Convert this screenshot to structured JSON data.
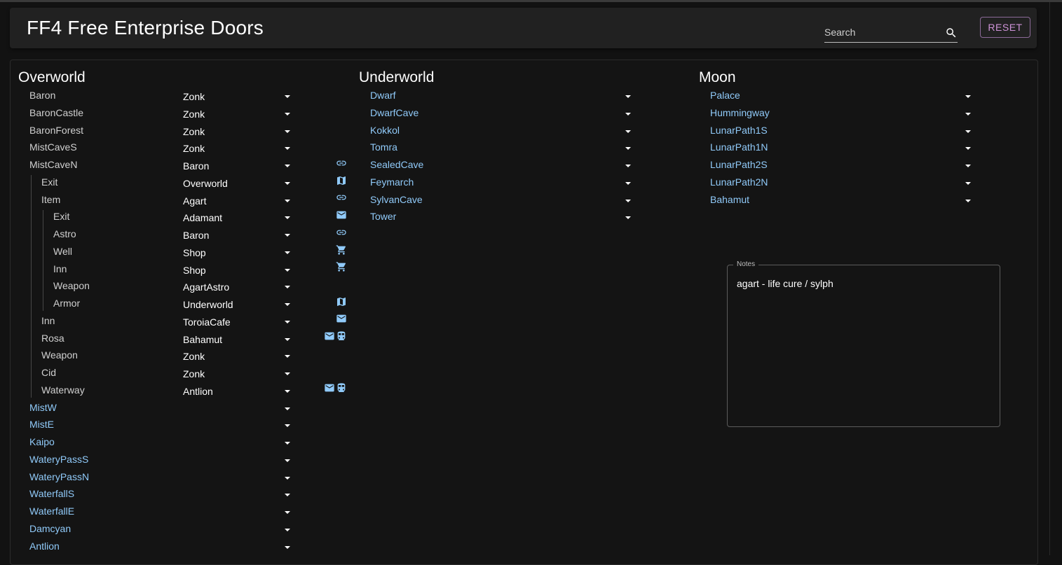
{
  "app": {
    "title": "FF4 Free Enterprise Doors",
    "search_placeholder": "Search",
    "reset_label": "RESET"
  },
  "overworld": {
    "heading": "Overworld",
    "rows": [
      {
        "label": "Baron",
        "value": "Zonk"
      },
      {
        "label": "BaronCastle",
        "value": "Zonk"
      },
      {
        "label": "BaronForest",
        "value": "Zonk"
      },
      {
        "label": "MistCaveS",
        "value": "Zonk"
      },
      {
        "label": "MistCaveN",
        "value": "Baron"
      },
      {
        "label": "Exit",
        "value": "Overworld"
      },
      {
        "label": "Item",
        "value": "Agart"
      },
      {
        "label": "Exit",
        "value": "Adamant"
      },
      {
        "label": "Astro",
        "value": "Baron"
      },
      {
        "label": "Well",
        "value": "Shop"
      },
      {
        "label": "Inn",
        "value": "Shop"
      },
      {
        "label": "Weapon",
        "value": "AgartAstro"
      },
      {
        "label": "Armor",
        "value": "Underworld"
      },
      {
        "label": "Inn",
        "value": "ToroiaCafe"
      },
      {
        "label": "Rosa",
        "value": "Bahamut"
      },
      {
        "label": "Weapon",
        "value": "Zonk"
      },
      {
        "label": "Cid",
        "value": "Zonk"
      },
      {
        "label": "Waterway",
        "value": "Antlion"
      },
      {
        "label": "MistW",
        "value": ""
      },
      {
        "label": "MistE",
        "value": ""
      },
      {
        "label": "Kaipo",
        "value": ""
      },
      {
        "label": "WateryPassS",
        "value": ""
      },
      {
        "label": "WateryPassN",
        "value": ""
      },
      {
        "label": "WaterfallS",
        "value": ""
      },
      {
        "label": "WaterfallE",
        "value": ""
      },
      {
        "label": "Damcyan",
        "value": ""
      },
      {
        "label": "Antlion",
        "value": ""
      }
    ]
  },
  "underworld": {
    "heading": "Underworld",
    "rows": [
      {
        "label": "Dwarf"
      },
      {
        "label": "DwarfCave"
      },
      {
        "label": "Kokkol"
      },
      {
        "label": "Tomra"
      },
      {
        "label": "SealedCave"
      },
      {
        "label": "Feymarch"
      },
      {
        "label": "SylvanCave"
      },
      {
        "label": "Tower"
      }
    ]
  },
  "moon": {
    "heading": "Moon",
    "rows": [
      {
        "label": "Palace"
      },
      {
        "label": "Hummingway"
      },
      {
        "label": "LunarPath1S"
      },
      {
        "label": "LunarPath1N"
      },
      {
        "label": "LunarPath2S"
      },
      {
        "label": "LunarPath2N"
      },
      {
        "label": "Bahamut"
      }
    ]
  },
  "icons": [
    "link-icon",
    "map-icon",
    "link-icon",
    "mail-icon",
    "link-icon",
    "cart-icon",
    "cart-icon",
    "map-icon",
    "mail-icon",
    "mail-icon",
    "train-icon",
    "mail-icon",
    "train-icon"
  ],
  "notes": {
    "label": "Notes",
    "text": "agart - life cure / sylph"
  },
  "colors": {
    "background": "#121212",
    "link": "#90caf9",
    "reset": "#ce93d8",
    "appbar": "#212121"
  }
}
